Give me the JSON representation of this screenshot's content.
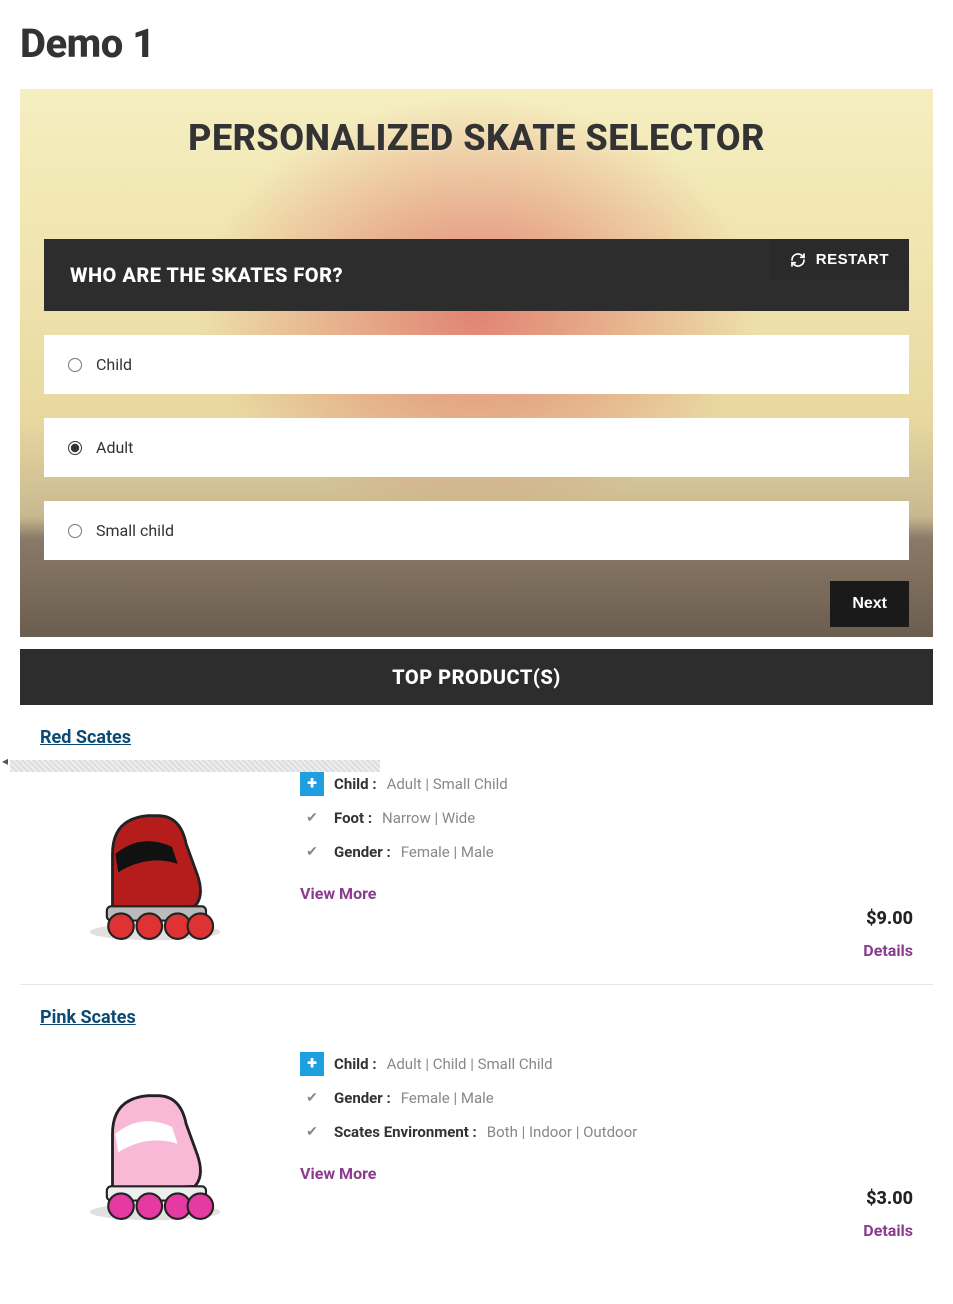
{
  "page_title": "Demo 1",
  "selector": {
    "heading": "PERSONALIZED SKATE SELECTOR",
    "restart_label": "RESTART",
    "question": "WHO ARE THE SKATES FOR?",
    "options": [
      "Child",
      "Adult",
      "Small child"
    ],
    "selected_index": 1,
    "next_label": "Next"
  },
  "top_products_heading": "TOP PRODUCT(S)",
  "view_more_label": "View More",
  "details_label": "Details",
  "products": [
    {
      "title": "Red Scates",
      "price": "$9.00",
      "attrs": [
        {
          "badge": "plus",
          "key": "Child :",
          "vals": "Adult | Small Child"
        },
        {
          "badge": "check",
          "key": "Foot :",
          "vals": "Narrow | Wide"
        },
        {
          "badge": "check",
          "key": "Gender :",
          "vals": "Female | Male"
        }
      ]
    },
    {
      "title": "Pink Scates",
      "price": "$3.00",
      "attrs": [
        {
          "badge": "plus",
          "key": "Child :",
          "vals": "Adult | Child | Small Child"
        },
        {
          "badge": "check",
          "key": "Gender :",
          "vals": "Female | Male"
        },
        {
          "badge": "check",
          "key": "Scates Environment :",
          "vals": "Both | Indoor | Outdoor"
        }
      ]
    }
  ]
}
